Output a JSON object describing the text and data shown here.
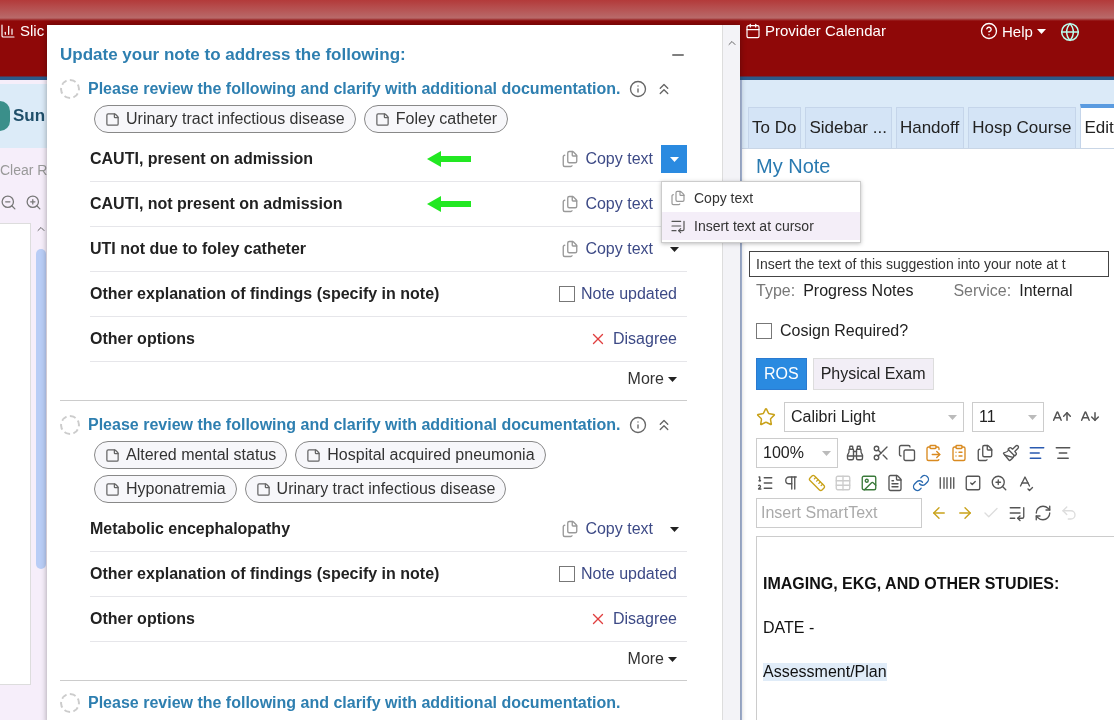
{
  "header": {
    "app_tab": "Slic",
    "calendar": "Provider Calendar",
    "help": "Help"
  },
  "left_panel": {
    "title": "Sun",
    "clear": "Clear R"
  },
  "suggestions": {
    "title": "Update your note to address the following:",
    "sections": [
      {
        "header": "Please review the following and clarify with additional documentation.",
        "chip_rows": [
          [
            "Urinary tract infectious disease",
            "Foley catheter"
          ]
        ],
        "rows": [
          {
            "kind": "copy",
            "label": "CAUTI, present on admission",
            "action": "Copy text",
            "arrow": true,
            "caret": true,
            "menu_open": true,
            "menu": [
              {
                "label": "Copy text",
                "selected": false
              },
              {
                "label": "Insert text at cursor",
                "selected": true
              }
            ],
            "tooltip": "Insert the text of this suggestion into your note at t"
          },
          {
            "kind": "copy",
            "label": "CAUTI, not present on admission",
            "action": "Copy text",
            "arrow": true,
            "caret": false,
            "menu_open": false
          },
          {
            "kind": "copy",
            "label": "UTI not due to foley catheter",
            "action": "Copy text",
            "arrow": false,
            "caret": true,
            "menu_open": false
          },
          {
            "kind": "note",
            "label": "Other explanation of findings (specify in note)",
            "action": "Note updated",
            "checked": false
          },
          {
            "kind": "disagree",
            "label": "Other options",
            "action": "Disagree"
          }
        ],
        "more": "More"
      },
      {
        "header": "Please review the following and clarify with additional documentation.",
        "chip_rows": [
          [
            "Altered mental status",
            "Hospital acquired pneumonia"
          ],
          [
            "Hyponatremia",
            "Urinary tract infectious disease"
          ]
        ],
        "rows": [
          {
            "kind": "copy",
            "label": "Metabolic encephalopathy",
            "action": "Copy text",
            "arrow": false,
            "caret": true,
            "menu_open": false
          },
          {
            "kind": "note",
            "label": "Other explanation of findings (specify in note)",
            "action": "Note updated",
            "checked": false
          },
          {
            "kind": "disagree",
            "label": "Other options",
            "action": "Disagree"
          }
        ],
        "more": "More"
      }
    ],
    "next_header": "Please review the following and clarify with additional documentation."
  },
  "note_tabs": [
    {
      "label": "To Do",
      "selected": false
    },
    {
      "label": "Sidebar ...",
      "selected": false
    },
    {
      "label": "Handoff",
      "selected": false
    },
    {
      "label": "Hosp Course",
      "selected": false
    },
    {
      "label": "Edit",
      "selected": true
    }
  ],
  "note": {
    "heading": "My Note",
    "type_label": "Type:",
    "type_value": "Progress Notes",
    "service_label": "Service:",
    "service_value": "Internal",
    "cosign": {
      "label": "Cosign Required?",
      "checked": false
    },
    "section_tabs": [
      {
        "label": "ROS",
        "selected": true
      },
      {
        "label": "Physical Exam",
        "selected": false
      }
    ],
    "font": "Calibri Light",
    "size": "11",
    "zoom": "100%",
    "smarttext_placeholder": "Insert SmartText",
    "body": [
      {
        "kind": "heading",
        "text": "IMAGING, EKG, AND OTHER STUDIES:"
      },
      {
        "kind": "plain",
        "text": "DATE -"
      },
      {
        "kind": "highlight",
        "text": "Assessment/Plan"
      }
    ]
  }
}
